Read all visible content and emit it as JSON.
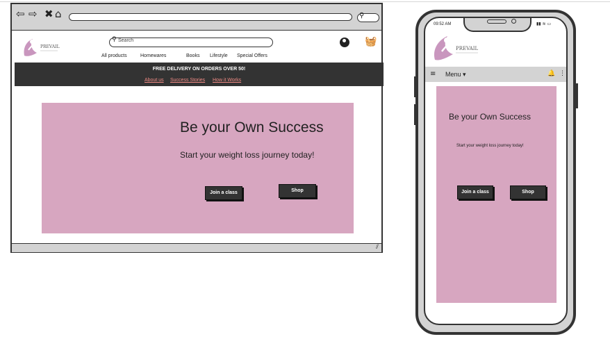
{
  "colors": {
    "hero_pink": "#d7a6c0",
    "promo_bar": "#333333",
    "link_coral": "#f08a84",
    "frame_gray": "#d3d3d3"
  },
  "browser": {
    "nav_icons": [
      "back-arrow-icon",
      "forward-arrow-icon",
      "close-icon",
      "home-icon"
    ],
    "search_icon": "search-icon"
  },
  "site": {
    "logo_text": "PREVAIL",
    "search_placeholder": "Search",
    "nav": [
      "All products",
      "Homewares",
      "Books",
      "Lifestyle",
      "Special Offers"
    ],
    "promo_title": "FREE DELIVERY ON ORDERS OVER 50!",
    "promo_links": [
      "About us",
      "Success Stories",
      "How it Works"
    ],
    "hero_title": "Be your Own Success",
    "hero_subtitle": "Start your weight loss journey today!",
    "btn_join": "Join a class",
    "btn_shop": "Shop"
  },
  "mobile": {
    "time": "09:52 AM",
    "logo_text": "PREVAIL",
    "menu_label": "Menu",
    "hero_title": "Be your Own Success",
    "hero_subtitle": "Start your weight loss journey today!",
    "btn_join": "Join a class",
    "btn_shop": "Shop"
  }
}
